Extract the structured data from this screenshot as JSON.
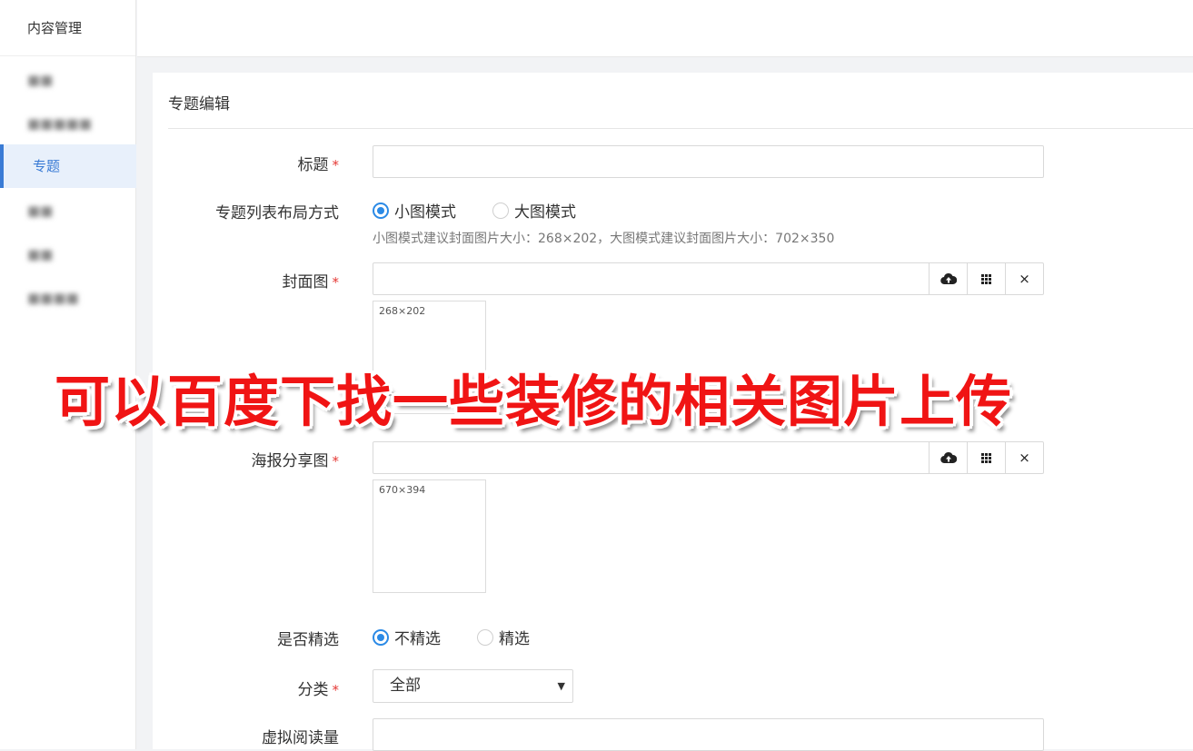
{
  "sidebar": {
    "header": "内容管理",
    "items": [
      {
        "label": "■■",
        "state": "blurred"
      },
      {
        "label": "■■■■■",
        "state": "blurred"
      },
      {
        "label": "专题",
        "state": "active"
      },
      {
        "label": "■■",
        "state": "blurred"
      },
      {
        "label": "■■",
        "state": "blurred"
      },
      {
        "label": "■■■■",
        "state": "blurred"
      }
    ]
  },
  "panel": {
    "title": "专题编辑"
  },
  "form": {
    "title": {
      "label": "标题",
      "required": "*",
      "value": ""
    },
    "layout": {
      "label": "专题列表布局方式",
      "options": [
        "小图模式",
        "大图模式"
      ],
      "selected": "小图模式",
      "hint": "小图模式建议封面图片大小：268×202，大图模式建议封面图片大小：702×350"
    },
    "cover": {
      "label": "封面图",
      "required": "*",
      "placeholder_size": "268×202",
      "buttons": [
        "upload-icon",
        "grid-icon",
        "close-icon"
      ],
      "close_glyph": "×"
    },
    "poster": {
      "label": "海报分享图",
      "required": "*",
      "placeholder_size": "670×394",
      "buttons": [
        "upload-icon",
        "grid-icon",
        "close-icon"
      ],
      "close_glyph": "×"
    },
    "featured": {
      "label": "是否精选",
      "options": [
        "不精选",
        "精选"
      ],
      "selected": "不精选"
    },
    "category": {
      "label": "分类",
      "required": "*",
      "value": "全部",
      "arrow": "▼"
    },
    "virtual_reads": {
      "label": "虚拟阅读量",
      "value": ""
    }
  },
  "overlay_text": "可以百度下找一些装修的相关图片上传",
  "colors": {
    "accent": "#2b8ae6",
    "required": "#e53935",
    "overlay": "#f01414"
  }
}
